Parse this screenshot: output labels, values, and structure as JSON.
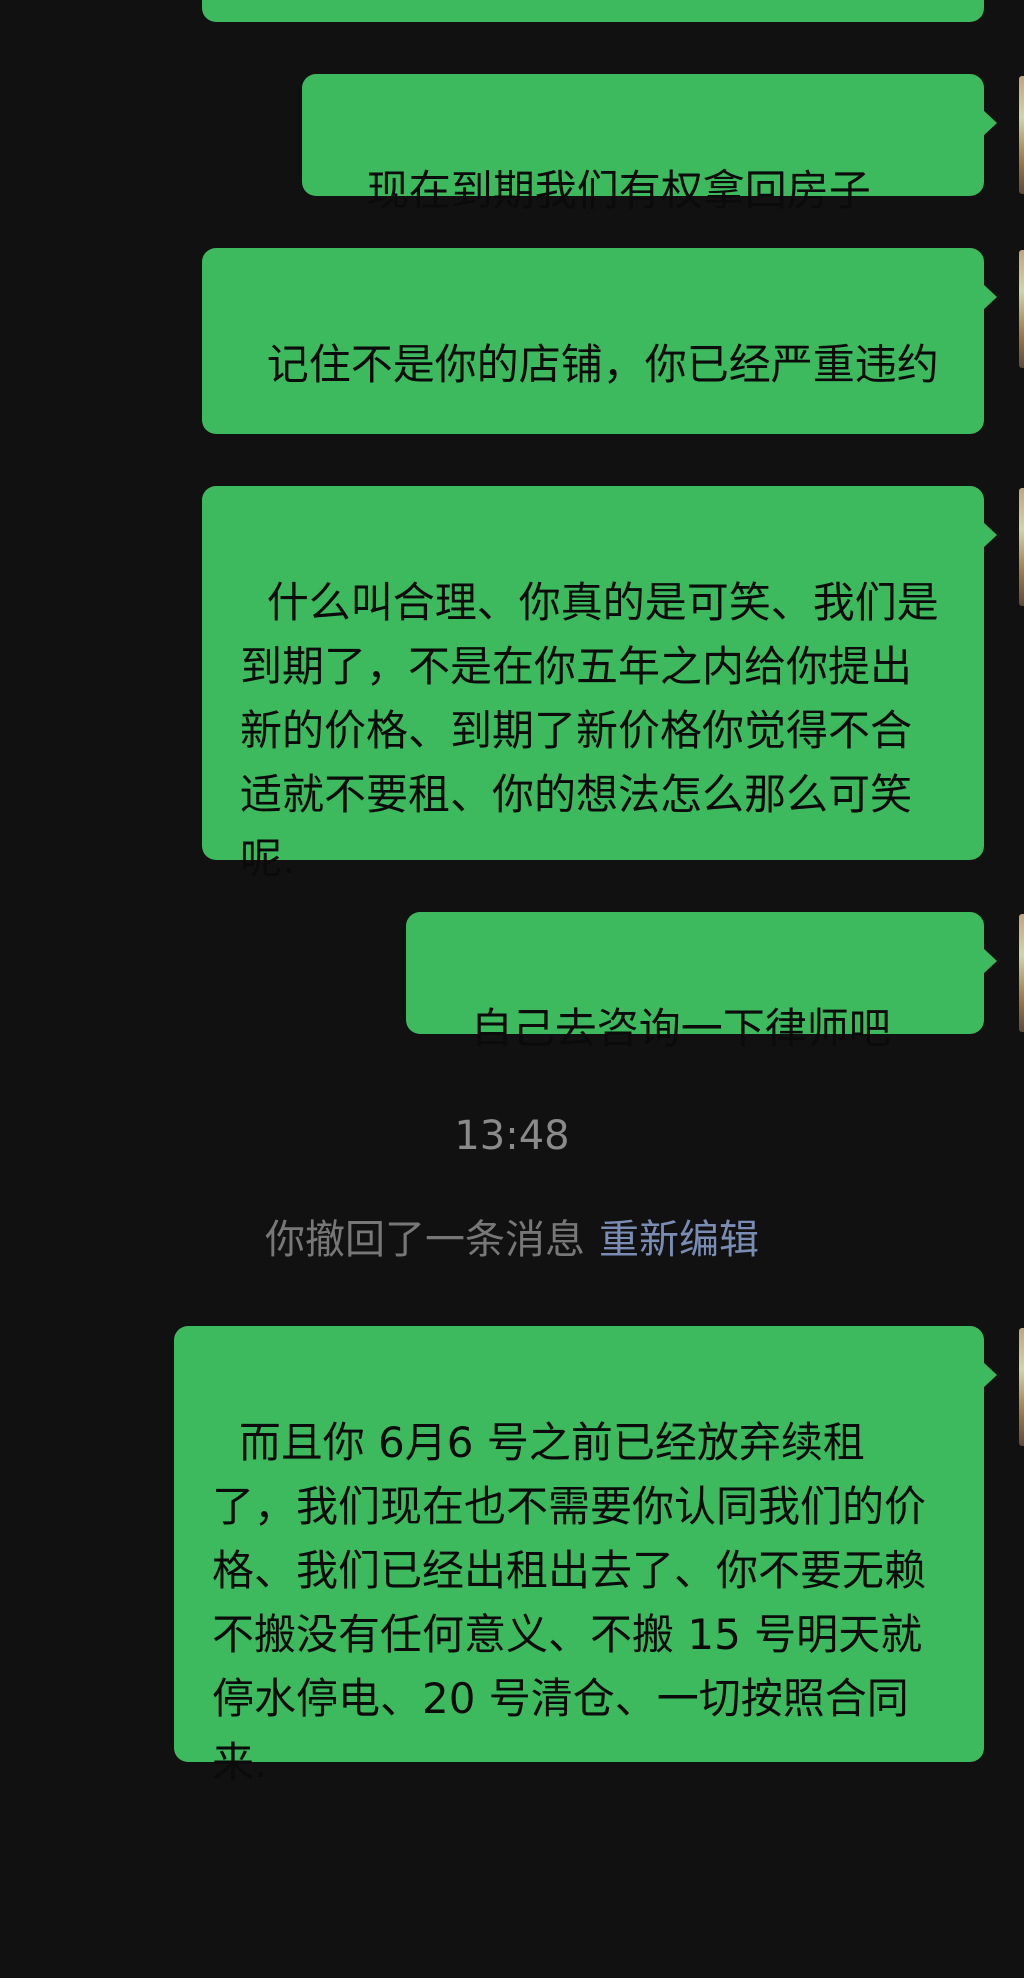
{
  "theme": {
    "background": "#111111",
    "bubble_color": "#3DB95E",
    "text_color": "#0b0b0b",
    "system_text_color": "#8a8a8a",
    "link_color": "#7a8cb4"
  },
  "messages": [
    {
      "sender": "me",
      "text": "现在到期我们有权拿回房子"
    },
    {
      "sender": "me",
      "text": "记住不是你的店铺，你已经严重违约"
    },
    {
      "sender": "me",
      "text": "什么叫合理、你真的是可笑、我们是到期了，不是在你五年之内给你提出新的价格、到期了新价格你觉得不合适就不要租、你的想法怎么那么可笑呢."
    },
    {
      "sender": "me",
      "text": "自己去咨询一下律师吧"
    },
    {
      "sender": "me",
      "text": "而且你 6月6 号之前已经放弃续租了，我们现在也不需要你认同我们的价格、我们已经出租出去了、你不要无赖不搬没有任何意义、不搬 15 号明天就停水停电、20 号清仓、一切按照合同来."
    }
  ],
  "timestamp": "13:48",
  "recall_notice": {
    "text": "你撤回了一条消息",
    "edit_label": "重新编辑"
  }
}
